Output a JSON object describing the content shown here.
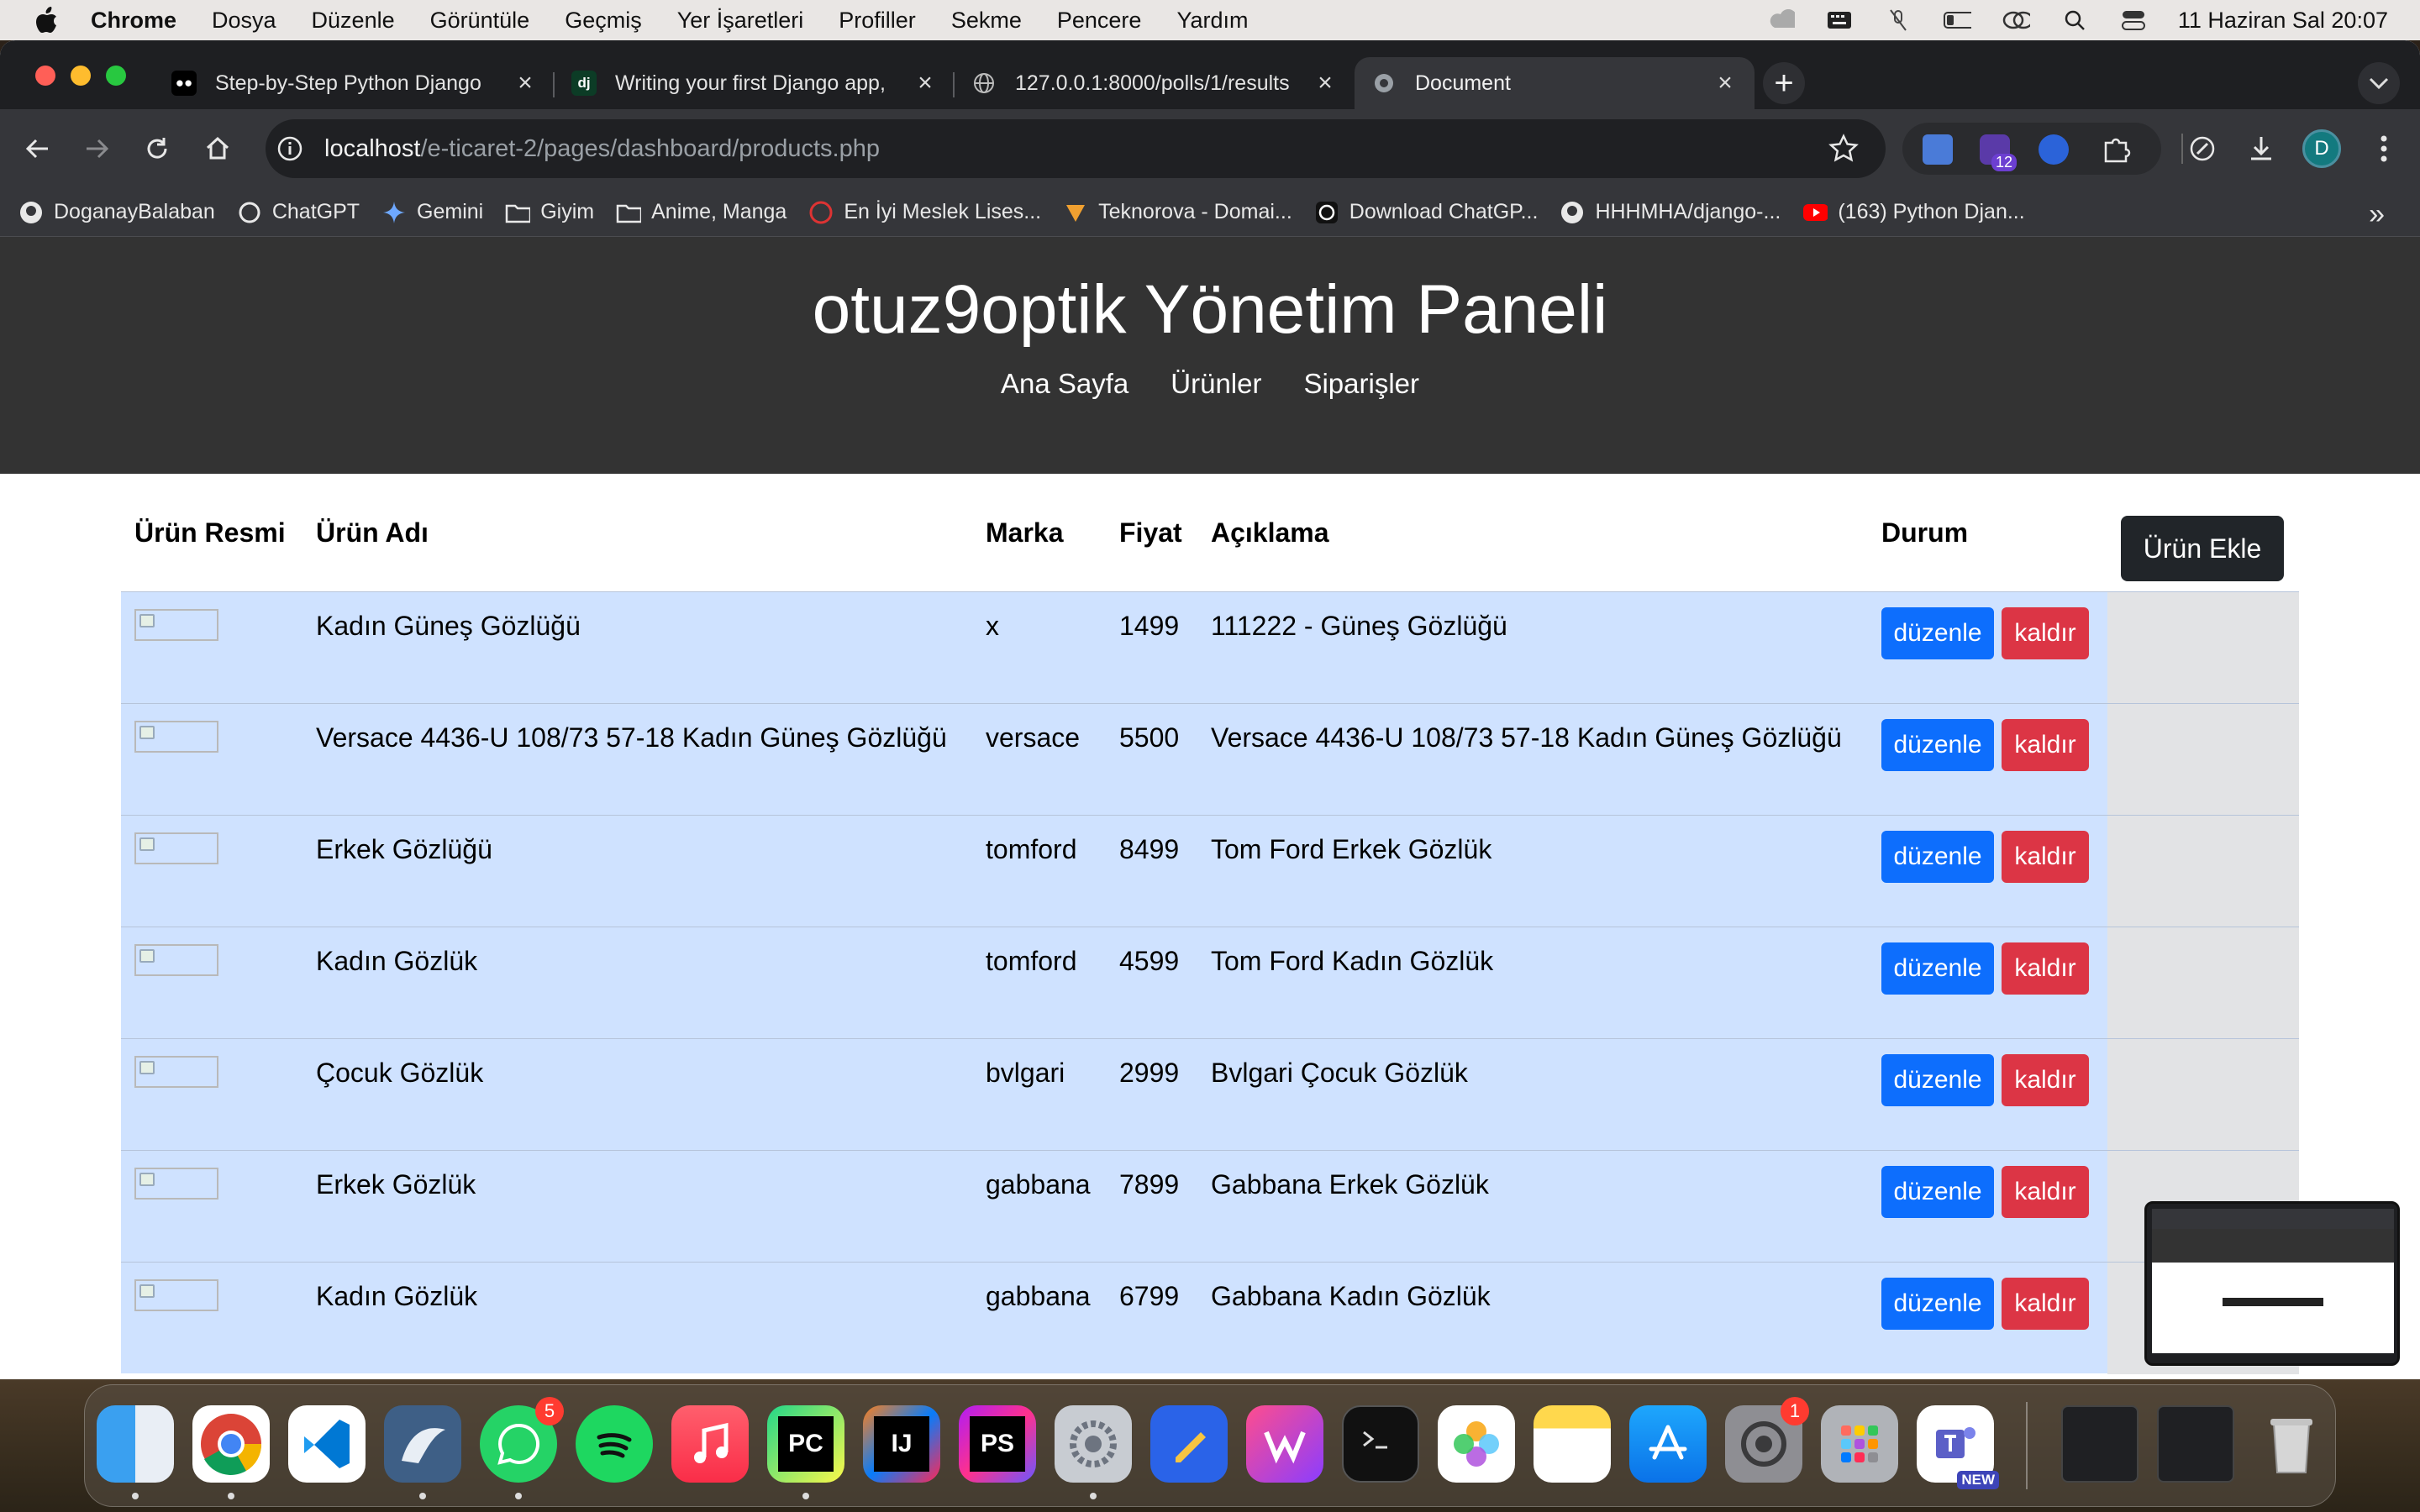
{
  "menubar": {
    "app": "Chrome",
    "items": [
      "Dosya",
      "Düzenle",
      "Görüntüle",
      "Geçmiş",
      "Yer İşaretleri",
      "Profiller",
      "Sekme",
      "Pencere",
      "Yardım"
    ],
    "clock": "11 Haziran Sal  20:07"
  },
  "browser": {
    "tabs": [
      {
        "title": "Step-by-Step Python Django",
        "favicon": "medium-icon"
      },
      {
        "title": "Writing your first Django app,",
        "favicon": "django-icon"
      },
      {
        "title": "127.0.0.1:8000/polls/1/results",
        "favicon": "globe-icon"
      },
      {
        "title": "Document",
        "favicon": "globe-icon",
        "active": true
      }
    ],
    "url_host": "localhost",
    "url_path": "/e-ticaret-2/pages/dashboard/products.php",
    "extension_badge": "12",
    "profile_initial": "D",
    "bookmarks": [
      "DoganayBalaban",
      "ChatGPT",
      "Gemini",
      "Giyim",
      "Anime, Manga",
      "En İyi Meslek Lises...",
      "Teknorova - Domai...",
      "Download ChatGP...",
      "HHHMHA/django-...",
      "(163) Python Djan..."
    ]
  },
  "site": {
    "title": "otuz9optik Yönetim Paneli",
    "nav": [
      "Ana Sayfa",
      "Ürünler",
      "Siparişler"
    ],
    "add_button": "Ürün Ekle",
    "columns": [
      "Ürün Resmi",
      "Ürün Adı",
      "Marka",
      "Fiyat",
      "Açıklama",
      "Durum"
    ],
    "edit_label": "düzenle",
    "delete_label": "kaldır",
    "products": [
      {
        "name": "Kadın Güneş Gözlüğü",
        "brand": "x",
        "price": "1499",
        "desc": "111222 - Güneş Gözlüğü"
      },
      {
        "name": "Versace 4436-U 108/73 57-18 Kadın Güneş Gözlüğü",
        "brand": "versace",
        "price": "5500",
        "desc": "Versace 4436-U 108/73 57-18 Kadın Güneş Gözlüğü"
      },
      {
        "name": "Erkek Gözlüğü",
        "brand": "tomford",
        "price": "8499",
        "desc": "Tom Ford Erkek Gözlük"
      },
      {
        "name": "Kadın Gözlük",
        "brand": "tomford",
        "price": "4599",
        "desc": "Tom Ford Kadın Gözlük"
      },
      {
        "name": "Çocuk Gözlük",
        "brand": "bvlgari",
        "price": "2999",
        "desc": "Bvlgari Çocuk Gözlük"
      },
      {
        "name": "Erkek Gözlük",
        "brand": "gabbana",
        "price": "7899",
        "desc": "Gabbana Erkek Gözlük"
      },
      {
        "name": "Kadın Gözlük",
        "brand": "gabbana",
        "price": "6799",
        "desc": "Gabbana Kadın Gözlük"
      }
    ]
  },
  "dock": {
    "whatsapp_badge": "5",
    "settings_badge": "1",
    "pycharm_label": "PC",
    "intellij_label": "IJ",
    "phpstorm_label": "PS",
    "teams_label": "NEW"
  },
  "colors": {
    "header_bg": "#333333",
    "row_bg": "#cfe2ff",
    "edit": "#0d6efd",
    "delete": "#dc3545",
    "add_button": "#212529"
  }
}
